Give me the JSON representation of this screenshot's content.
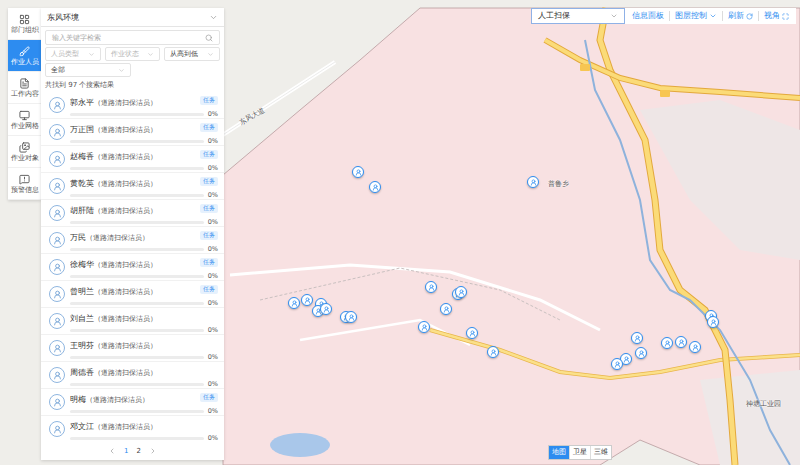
{
  "header": {
    "org": "东风环境"
  },
  "rail": [
    {
      "label": "部门组织",
      "selected": false
    },
    {
      "label": "作业人员",
      "selected": true
    },
    {
      "label": "工作内容",
      "selected": false
    },
    {
      "label": "作业网格",
      "selected": false
    },
    {
      "label": "作业对象",
      "selected": false
    },
    {
      "label": "预警信息",
      "selected": false
    }
  ],
  "panel": {
    "search_placeholder": "输入关键字检索",
    "filters": [
      {
        "label": "人员类型",
        "placeholder": true
      },
      {
        "label": "作业状态",
        "placeholder": true
      },
      {
        "label": "从高到低",
        "placeholder": false
      }
    ],
    "status_filter": "全部",
    "result_count": "共找到 97 个搜索结果",
    "task_badge": "任务"
  },
  "workers": [
    {
      "name": "郭永平",
      "role": "（道路清扫保洁员）",
      "task": true,
      "level": 0,
      "reading": "0%"
    },
    {
      "name": "万正国",
      "role": "（道路清扫保洁员）",
      "task": true,
      "level": 0,
      "reading": "0%"
    },
    {
      "name": "赵梅香",
      "role": "（道路清扫保洁员）",
      "task": true,
      "level": 0,
      "reading": "0%"
    },
    {
      "name": "黄乾英",
      "role": "（道路清扫保洁员）",
      "task": true,
      "level": 0,
      "reading": "0%"
    },
    {
      "name": "胡肝陆",
      "role": "（道路清扫保洁员）",
      "task": true,
      "level": 0,
      "reading": "0%"
    },
    {
      "name": "万民",
      "role": "（道路清扫保洁员）",
      "task": true,
      "level": 0,
      "reading": "0%"
    },
    {
      "name": "徐梅华",
      "role": "（道路清扫保洁员）",
      "task": true,
      "level": 0,
      "reading": "0%"
    },
    {
      "name": "曾明兰",
      "role": "（道路清扫保洁员）",
      "task": true,
      "level": 0,
      "reading": "0%"
    },
    {
      "name": "刘自兰",
      "role": "（道路清扫保洁员）",
      "task": false,
      "level": 0,
      "reading": "0%"
    },
    {
      "name": "王明芬",
      "role": "（道路清扫保洁员）",
      "task": false,
      "level": 0,
      "reading": "0%"
    },
    {
      "name": "周德香",
      "role": "（道路清扫保洁员）",
      "task": false,
      "level": 0,
      "reading": "0%"
    },
    {
      "name": "明梅",
      "role": "（道路清扫保洁员）",
      "task": true,
      "level": 0,
      "reading": "0%"
    },
    {
      "name": "邓文江",
      "role": "（道路清扫保洁员）",
      "task": false,
      "level": 0,
      "reading": "0%"
    }
  ],
  "pagination": {
    "pages": [
      {
        "label": "1",
        "selected": true
      },
      {
        "label": "2",
        "selected": false
      }
    ]
  },
  "toolbar": {
    "mode": "人工扫保",
    "buttons": [
      {
        "label": "信息面板",
        "kind": "plain"
      },
      {
        "label": "图层控制",
        "kind": "dropdown"
      },
      {
        "label": "刷新",
        "kind": "refresh"
      },
      {
        "label": "视角",
        "kind": "fullscreen"
      }
    ]
  },
  "map": {
    "labels": [
      "东风大道",
      "普鲁乡",
      "神塘工业园"
    ],
    "types": [
      {
        "label": "地图",
        "selected": true
      },
      {
        "label": "卫星",
        "selected": false
      },
      {
        "label": "三维",
        "selected": false
      }
    ]
  }
}
